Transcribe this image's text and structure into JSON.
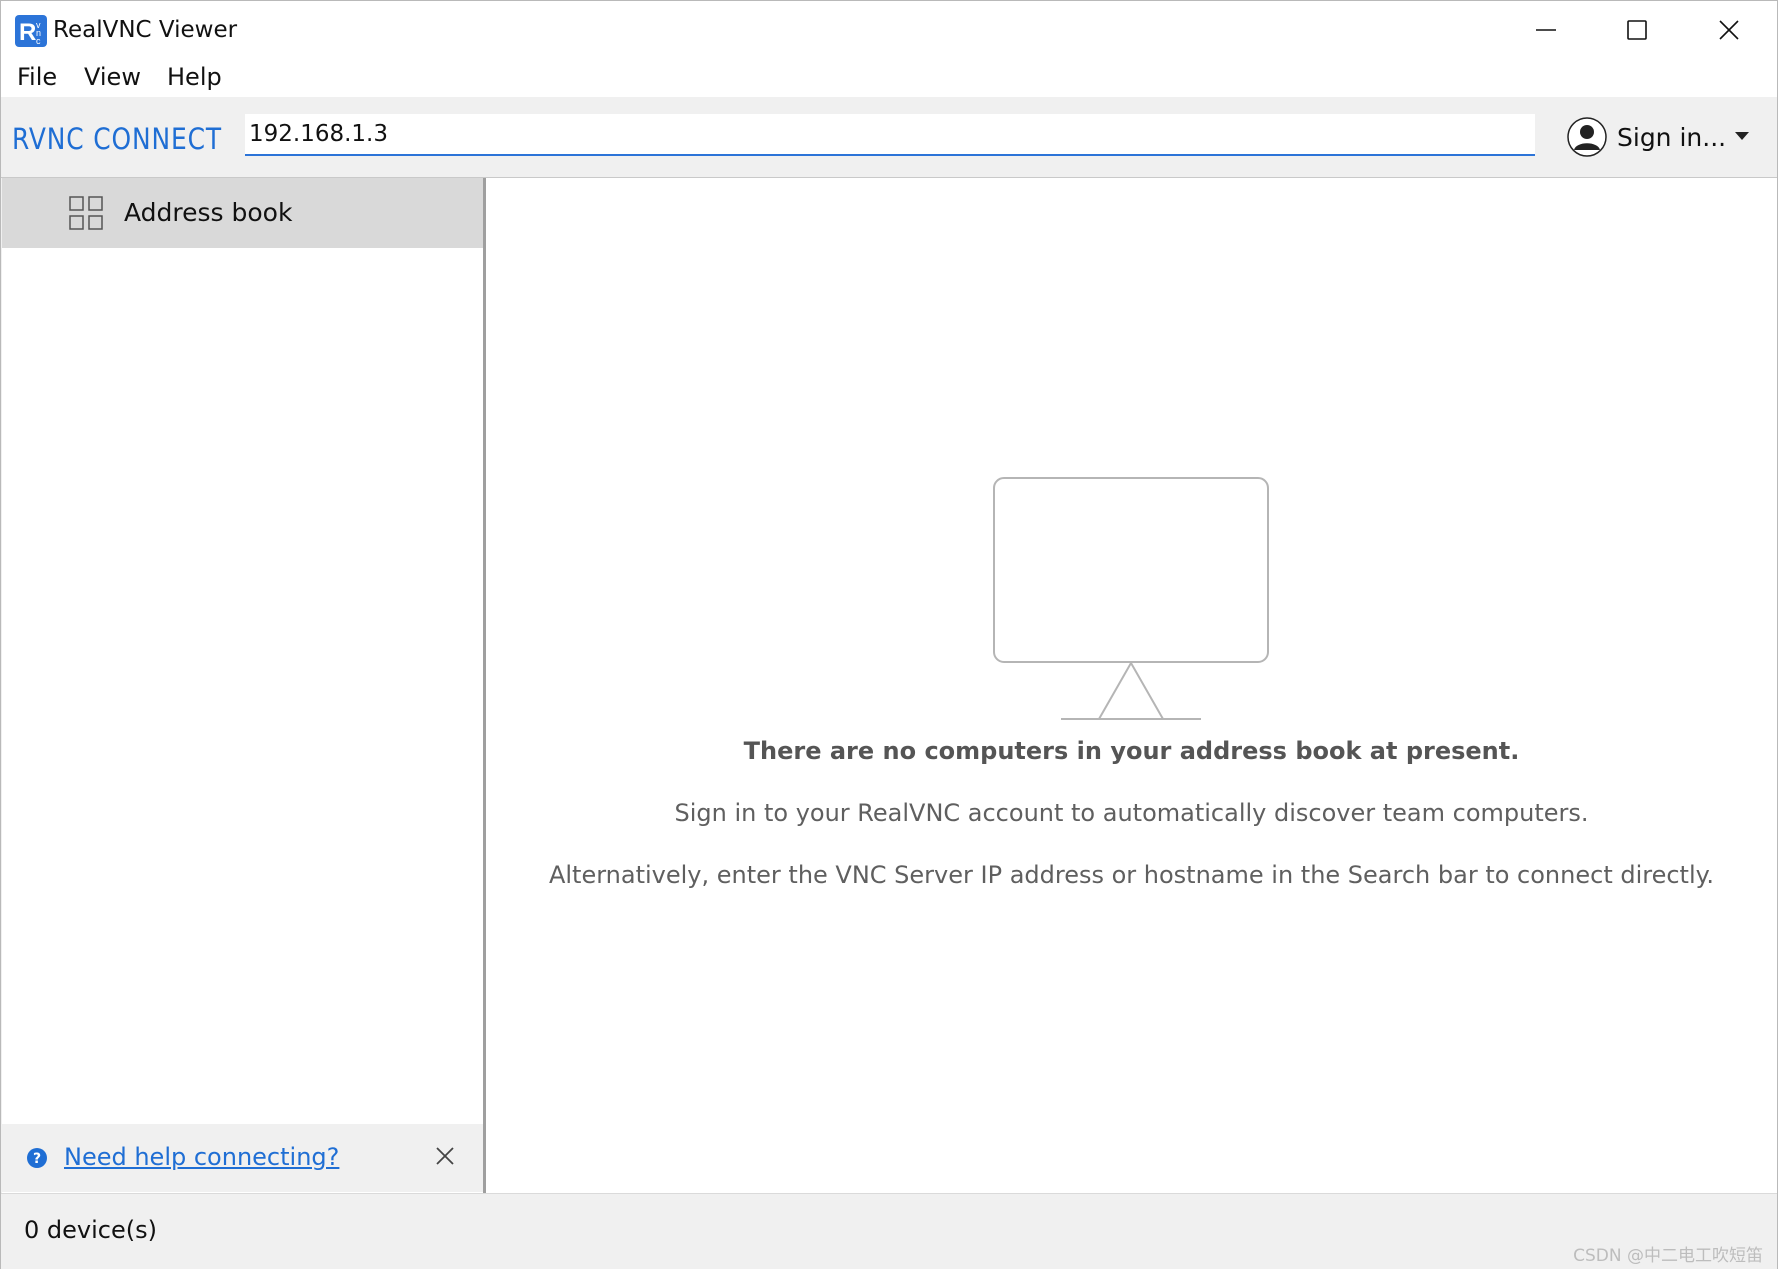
{
  "window": {
    "title": "RealVNC Viewer"
  },
  "menu": [
    "File",
    "View",
    "Help"
  ],
  "toolbar": {
    "brand": "RVNC CONNECT",
    "search_value": "192.168.1.3",
    "sign_in_label": "Sign in..."
  },
  "sidebar": {
    "items": [
      {
        "label": "Address book",
        "icon": "grid-icon"
      }
    ],
    "help_link": "Need help connecting?"
  },
  "main": {
    "empty_title": "There are no computers in your address book at present.",
    "empty_line1": "Sign in to your RealVNC account to automatically discover team computers.",
    "empty_line2": "Alternatively, enter the VNC Server IP address or hostname in the Search bar to connect directly."
  },
  "status": {
    "device_count": "0 device(s)"
  },
  "watermark": "CSDN @中二电工吹短笛",
  "colors": {
    "accent": "#2c74d8",
    "link": "#1f6ed4",
    "selected_item_bg": "#d9d9d9"
  }
}
